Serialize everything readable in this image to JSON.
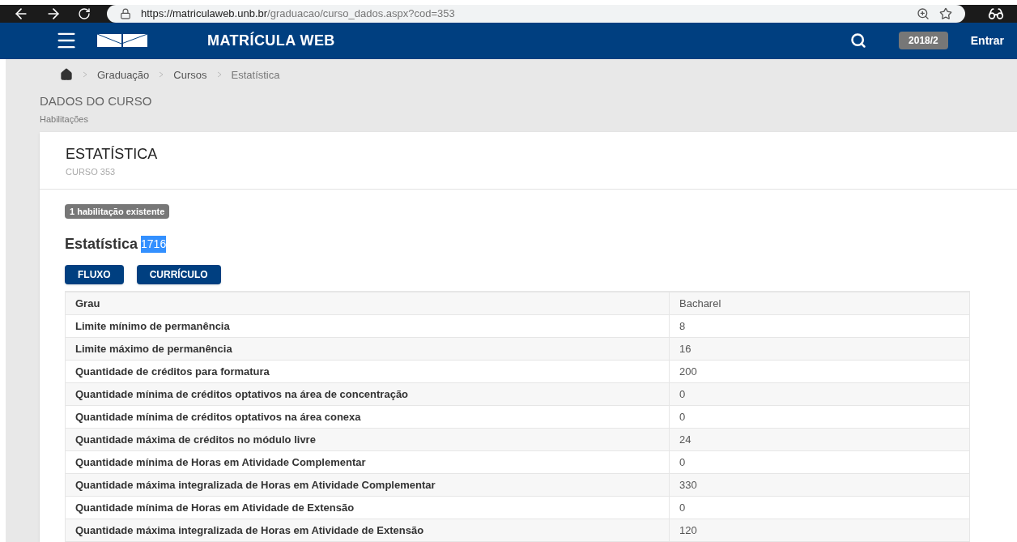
{
  "browser": {
    "url_host": "https://matriculaweb.unb.br",
    "url_path": "/graduacao/curso_dados.aspx?cod=353"
  },
  "header": {
    "title": "MATRÍCULA WEB",
    "period": "2018/2",
    "login": "Entrar"
  },
  "breadcrumb": [
    "Graduação",
    "Cursos",
    "Estatística"
  ],
  "page": {
    "title": "DADOS DO CURSO",
    "subtitle": "Habilitações"
  },
  "card": {
    "title": "ESTATÍSTICA",
    "subtitle": "CURSO 353",
    "badge": "1 habilitação existente",
    "heading": "Estatística",
    "code": {
      "text": "1716",
      "highlighted": true
    },
    "buttons": [
      "FLUXO",
      "CURRÍCULO"
    ]
  },
  "table": {
    "rows": [
      {
        "label": "Grau",
        "value": "Bacharel"
      },
      {
        "label": "Limite mínimo de permanência",
        "value": "8"
      },
      {
        "label": "Limite máximo de permanência",
        "value": "16"
      },
      {
        "label": "Quantidade de créditos para formatura",
        "value": "200"
      },
      {
        "label": "Quantidade mínima de créditos optativos na área de concentração",
        "value": "0"
      },
      {
        "label": "Quantidade mínima de créditos optativos na área conexa",
        "value": "0"
      },
      {
        "label": "Quantidade máxima de créditos no módulo livre",
        "value": "24"
      },
      {
        "label": "Quantidade mínima de Horas em Atividade Complementar",
        "value": "0"
      },
      {
        "label": "Quantidade máxima integralizada de Horas em Atividade Complementar",
        "value": "330"
      },
      {
        "label": "Quantidade mínima de Horas em Atividade de Extensão",
        "value": "0"
      },
      {
        "label": "Quantidade máxima integralizada de Horas em Atividade de Extensão",
        "value": "120"
      }
    ]
  }
}
